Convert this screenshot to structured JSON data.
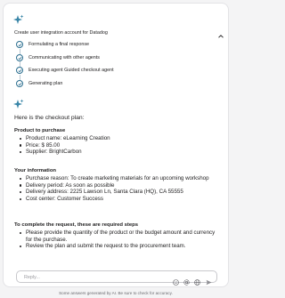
{
  "task": {
    "title": "Create user integration account for Datadog",
    "steps": [
      {
        "label": "Formulating a final response"
      },
      {
        "label": "Communicating with other agents"
      },
      {
        "label": "Executing agent Guided checkout agent"
      },
      {
        "label": "Generating plan"
      }
    ]
  },
  "response": {
    "intro": "Here is the checkout plan:",
    "sections": [
      {
        "title": "Product to purchase",
        "items": [
          "Product name: eLearning Creation",
          "Price: $ 85.00",
          "Supplier: BrightCarbon"
        ]
      },
      {
        "title": "Your information",
        "items": [
          "Purchase reason: To create marketing materials for an upcoming workshop",
          "Delivery period: As soon as possible",
          "Delivery address: 2225 Lawson Ln, Santa Clara (HQ), CA 55555",
          "Cost center: Customer Success"
        ]
      },
      {
        "title": "To complete the request, these are required steps",
        "items": [
          "Please provide the quantity of the product or the budget amount and currency for the purchase.",
          "Review the plan and submit the request to the procurement team."
        ]
      }
    ]
  },
  "composer": {
    "placeholder": "Reply...",
    "icons": [
      "emoji-icon",
      "at-icon",
      "globe-icon",
      "send-icon"
    ]
  },
  "footer": {
    "disclaimer": "Some answers generated by AI. Be sure to check for accuracy."
  },
  "colors": {
    "sparkle": "#3a86a8",
    "check": "#2b6e8f",
    "page_bg": "#f4f4f5",
    "card_bg": "#ffffff"
  }
}
